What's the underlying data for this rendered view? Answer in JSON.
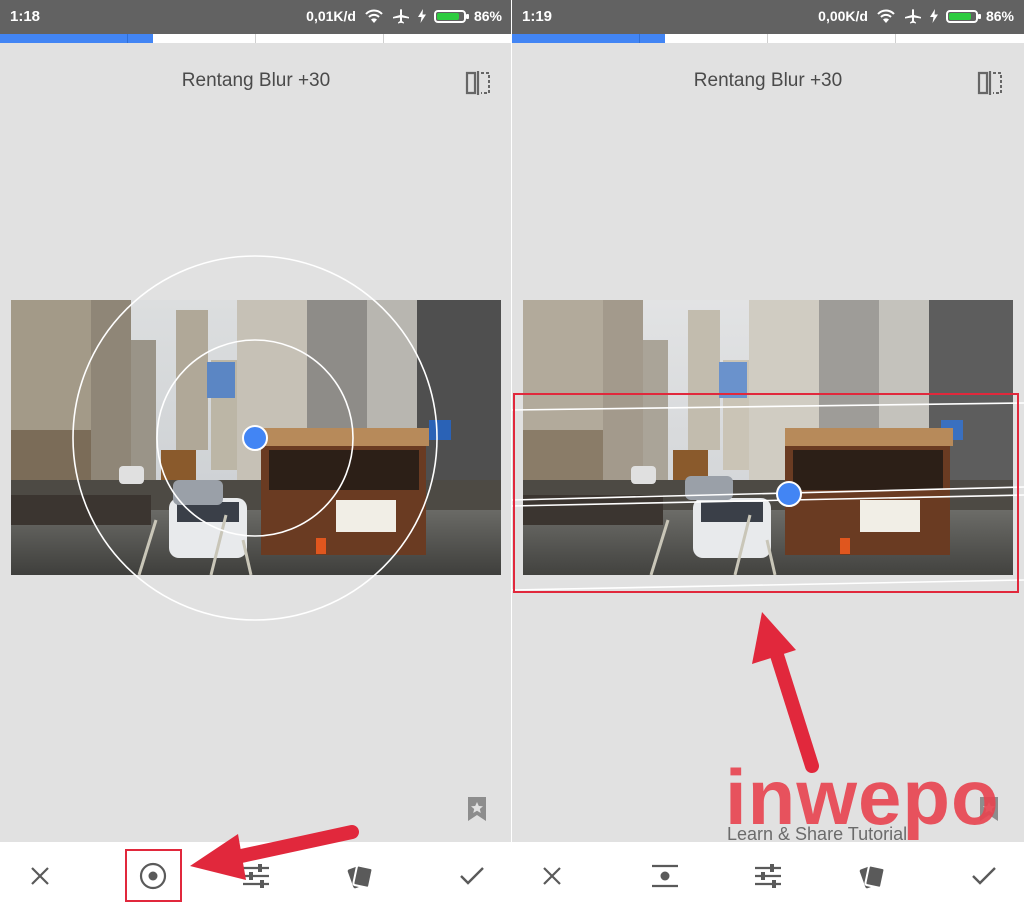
{
  "colors": {
    "statusbar": "#626262",
    "accent_blue": "#4285f4",
    "battery_green": "#2ecc40",
    "annotation_red": "#e1283c",
    "watermark_red": "#e8434f",
    "toolbar_icon": "#5a5a5a"
  },
  "left": {
    "status": {
      "time": "1:18",
      "speed": "0,01K/d",
      "battery_pct": "86%",
      "battery_level": 0.86
    },
    "title": "Rentang Blur +30",
    "toolbar": [
      {
        "name": "cancel",
        "icon": "close-icon"
      },
      {
        "name": "shape-radial",
        "icon": "radial-icon",
        "selected": true
      },
      {
        "name": "adjust",
        "icon": "sliders-icon"
      },
      {
        "name": "style",
        "icon": "cards-icon"
      },
      {
        "name": "apply",
        "icon": "check-icon"
      }
    ]
  },
  "right": {
    "status": {
      "time": "1:19",
      "speed": "0,00K/d",
      "battery_pct": "86%",
      "battery_level": 0.86
    },
    "title": "Rentang Blur +30",
    "toolbar": [
      {
        "name": "cancel",
        "icon": "close-icon"
      },
      {
        "name": "shape-linear",
        "icon": "linear-icon"
      },
      {
        "name": "adjust",
        "icon": "sliders-icon"
      },
      {
        "name": "style",
        "icon": "cards-icon"
      },
      {
        "name": "apply",
        "icon": "check-icon"
      }
    ]
  },
  "watermark": {
    "brand": "inwepo",
    "tagline": "Learn & Share Tutorial"
  }
}
